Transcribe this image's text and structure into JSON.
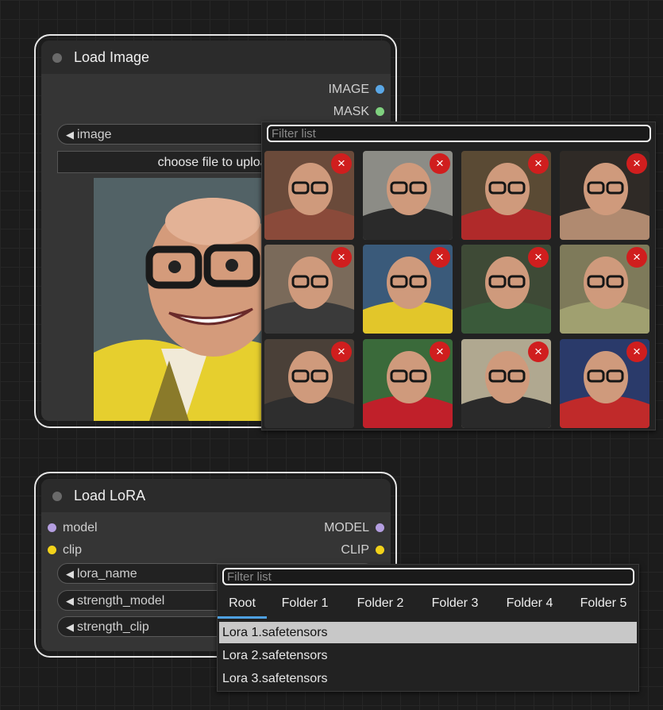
{
  "load_image_node": {
    "title": "Load Image",
    "outputs": [
      {
        "label": "IMAGE",
        "color": "#5aa7e6"
      },
      {
        "label": "MASK",
        "color": "#7fd17f"
      }
    ],
    "image_widget_label": "image",
    "upload_button_label": "choose file to upload",
    "image_dropdown": {
      "filter_placeholder": "Filter list",
      "thumbnails": [
        {
          "subject": "photo-1",
          "remove_icon": "×"
        },
        {
          "subject": "photo-2",
          "remove_icon": "×"
        },
        {
          "subject": "photo-3",
          "remove_icon": "×"
        },
        {
          "subject": "photo-4",
          "remove_icon": "×"
        },
        {
          "subject": "photo-5",
          "remove_icon": "×"
        },
        {
          "subject": "photo-6",
          "remove_icon": "×"
        },
        {
          "subject": "photo-7",
          "remove_icon": "×"
        },
        {
          "subject": "photo-8",
          "remove_icon": "×"
        },
        {
          "subject": "photo-9",
          "remove_icon": "×"
        },
        {
          "subject": "photo-10",
          "remove_icon": "×"
        },
        {
          "subject": "photo-11",
          "remove_icon": "×"
        },
        {
          "subject": "photo-12",
          "remove_icon": "×"
        }
      ]
    }
  },
  "load_lora_node": {
    "title": "Load LoRA",
    "inputs": [
      {
        "label": "model",
        "color": "#b49ee0"
      },
      {
        "label": "clip",
        "color": "#f2d21a"
      }
    ],
    "outputs": [
      {
        "label": "MODEL",
        "color": "#b49ee0"
      },
      {
        "label": "CLIP",
        "color": "#f2d21a"
      }
    ],
    "widgets": [
      {
        "label": "lora_name"
      },
      {
        "label": "strength_model"
      },
      {
        "label": "strength_clip"
      }
    ],
    "lora_dropdown": {
      "filter_placeholder": "Filter list",
      "tabs": [
        "Root",
        "Folder 1",
        "Folder 2",
        "Folder 3",
        "Folder 4",
        "Folder 5"
      ],
      "active_tab": "Root",
      "items": [
        "Lora 1.safetensors",
        "Lora 2.safetensors",
        "Lora 3.safetensors"
      ],
      "selected_item": "Lora 1.safetensors"
    }
  },
  "colors": {
    "canvas_bg": "#1c1c1c",
    "node_bg": "#353535",
    "remove_button": "#d01e1e",
    "active_tab_underline": "#4ea0e0"
  }
}
